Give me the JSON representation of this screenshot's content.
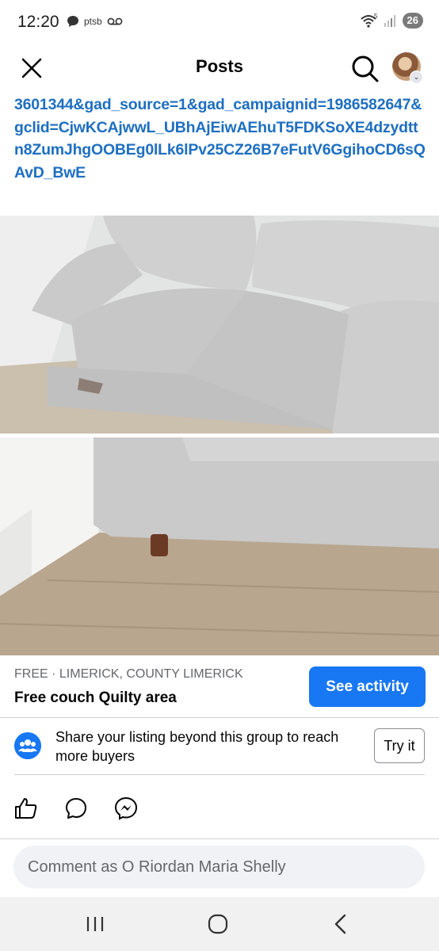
{
  "status_bar": {
    "time": "12:20",
    "carrier": "ptsb",
    "battery": "26",
    "wifi_label": "5"
  },
  "header": {
    "title": "Posts"
  },
  "post": {
    "link_text": "3601344&gad_source=1&gad_campaignid=1986582647&gclid=CjwKCAjwwL_UBhAjEiwAEhuT5FDKSoXE4dzydttn8ZumJhgOOBEg0lLk6lPv25CZ26B7eFutV6GgihoCD6sQAvD_BwE"
  },
  "listing": {
    "meta": "FREE · LIMERICK, COUNTY LIMERICK",
    "title": "Free couch Quilty area",
    "activity_button": "See activity"
  },
  "share": {
    "text": "Share your listing beyond this group to reach more buyers",
    "button": "Try it"
  },
  "comment": {
    "placeholder": "Comment as O Riordan Maria Shelly"
  },
  "colors": {
    "accent": "#1877f2",
    "link": "#1e6fc1"
  }
}
